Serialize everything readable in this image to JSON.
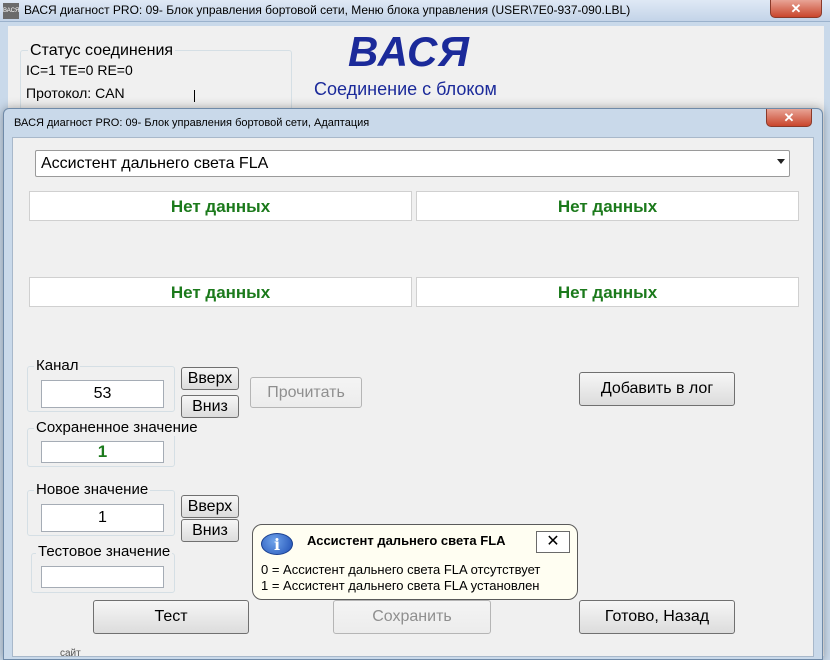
{
  "main_window": {
    "title": "ВАСЯ диагност PRO: 09- Блок управления бортовой сети,  Меню блока управления (USER\\7E0-937-090.LBL)",
    "app_icon_text": "ВАСЯ",
    "close_symbol": "✕",
    "brand": "ВАСЯ",
    "brand_subtitle": "Соединение с блоком",
    "status": {
      "title": "Статус соединения",
      "counters": "IC=1  TE=0   RE=0",
      "protocol": "Протокол: CAN"
    },
    "bottom_text": "сайт"
  },
  "dialog": {
    "title": "ВАСЯ диагност PRO: 09- Блок управления бортовой сети, Адаптация",
    "close_symbol": "✕",
    "function_select": {
      "value": "Ассистент дальнего света FLA"
    },
    "data_fields": [
      "Нет данных",
      "Нет данных",
      "Нет данных",
      "Нет данных"
    ],
    "channel": {
      "label": "Канал",
      "value": "53",
      "up_label": "Вверх",
      "down_label": "Вниз"
    },
    "read_button": "Прочитать",
    "add_log_button": "Добавить в лог",
    "saved_value": {
      "label": "Сохраненное значение",
      "value": "1"
    },
    "new_value": {
      "label": "Новое значение",
      "value": "1",
      "up_label": "Вверх",
      "down_label": "Вниз"
    },
    "test_value": {
      "label": "Тестовое значение",
      "value": ""
    },
    "buttons": {
      "test": "Тест",
      "save": "Сохранить",
      "done": "Готово, Назад"
    },
    "tooltip": {
      "icon": "i",
      "title": "Ассистент дальнего света FLA",
      "close_symbol": "✕",
      "line1": "0 = Ассистент дальнего света FLA отсутствует",
      "line2": "1 = Ассистент дальнего света FLA установлен"
    }
  },
  "colors": {
    "brand": "#1b2a9a",
    "data_text": "#1c7a1c",
    "close_button": "#c9462c"
  }
}
